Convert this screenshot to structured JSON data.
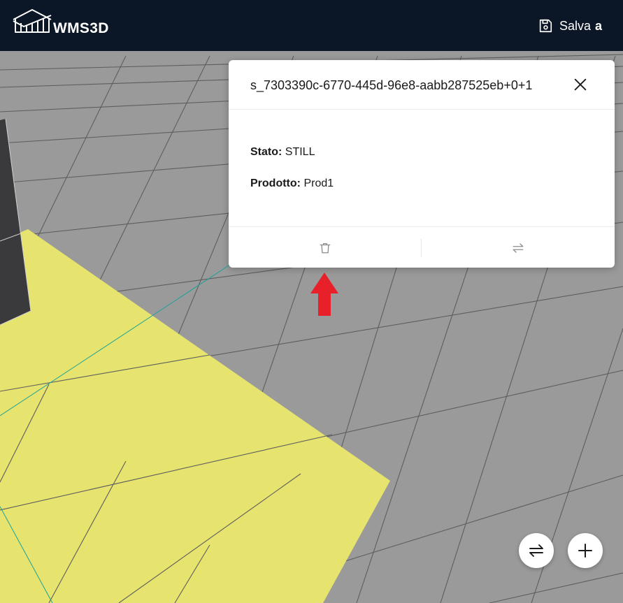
{
  "app": {
    "logo_text": "WMS3D",
    "logo_icon": "warehouse-icon"
  },
  "header": {
    "save_label": "Salva",
    "save_user": "a",
    "save_icon": "floppy-disk-icon"
  },
  "panel": {
    "title": "s_7303390c-6770-445d-96e8-aabb287525eb+0+1",
    "close_icon": "close-icon",
    "fields": [
      {
        "label": "Stato:",
        "value": "STILL"
      },
      {
        "label": "Prodotto:",
        "value": "Prod1"
      }
    ],
    "actions": [
      {
        "icon": "trash-icon",
        "name": "delete"
      },
      {
        "icon": "swap-arrows-icon",
        "name": "move"
      }
    ]
  },
  "fabs": [
    {
      "icon": "swap-arrows-icon",
      "name": "swap"
    },
    {
      "icon": "plus-icon",
      "name": "add"
    }
  ],
  "colors": {
    "header_bg": "#0b1626",
    "floor": "#9a9a9a",
    "zone": "#e6e36e",
    "rack": "#3a3a3c",
    "arrow": "#e8202a"
  }
}
